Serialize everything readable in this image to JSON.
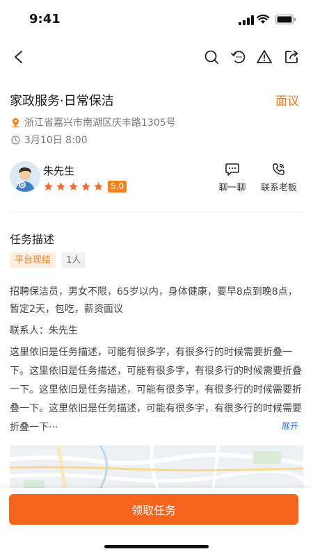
{
  "status_bar": {
    "time": "9:41"
  },
  "header": {
    "icons": [
      "back-arrow-icon",
      "search-icon",
      "refresh-icon",
      "warning-icon",
      "share-icon"
    ]
  },
  "job": {
    "title": "家政服务·日常保洁",
    "price": "面议",
    "address": "浙江省嘉兴市南湖区庆丰路1305号",
    "time": "3月10日 8:00"
  },
  "publisher": {
    "name": "朱先生",
    "rating": "5.0",
    "stars": 5,
    "actions": {
      "chat": "聊一聊",
      "contact": "联系老板"
    }
  },
  "description": {
    "section_title": "任务描述",
    "tags": {
      "source": "平台现结",
      "count": "1人"
    },
    "summary": "招聘保洁员，男女不限，65岁以内，身体健康，要早8点到晚8点，暂定2天，包吃，薪资面议",
    "contact": "联系人：朱先生",
    "detail": "这里依旧是任务描述，可能有很多字，有很多行的时候需要折叠一下。这里依旧是任务描述，可能有很多字，有很多行的时候需要折叠一下。这里依旧是任务描述，可能有很多字，有很多行的时候需要折叠一下。这里依旧是任务描述，可能有很多字，有很多行的时候需要折叠一下···",
    "expand_label": "展开"
  },
  "bottom_bar": {
    "cta_label": "领取任务"
  },
  "colors": {
    "accent": "#f5641c",
    "price": "#f07a1c",
    "link": "#2f6fd6"
  }
}
